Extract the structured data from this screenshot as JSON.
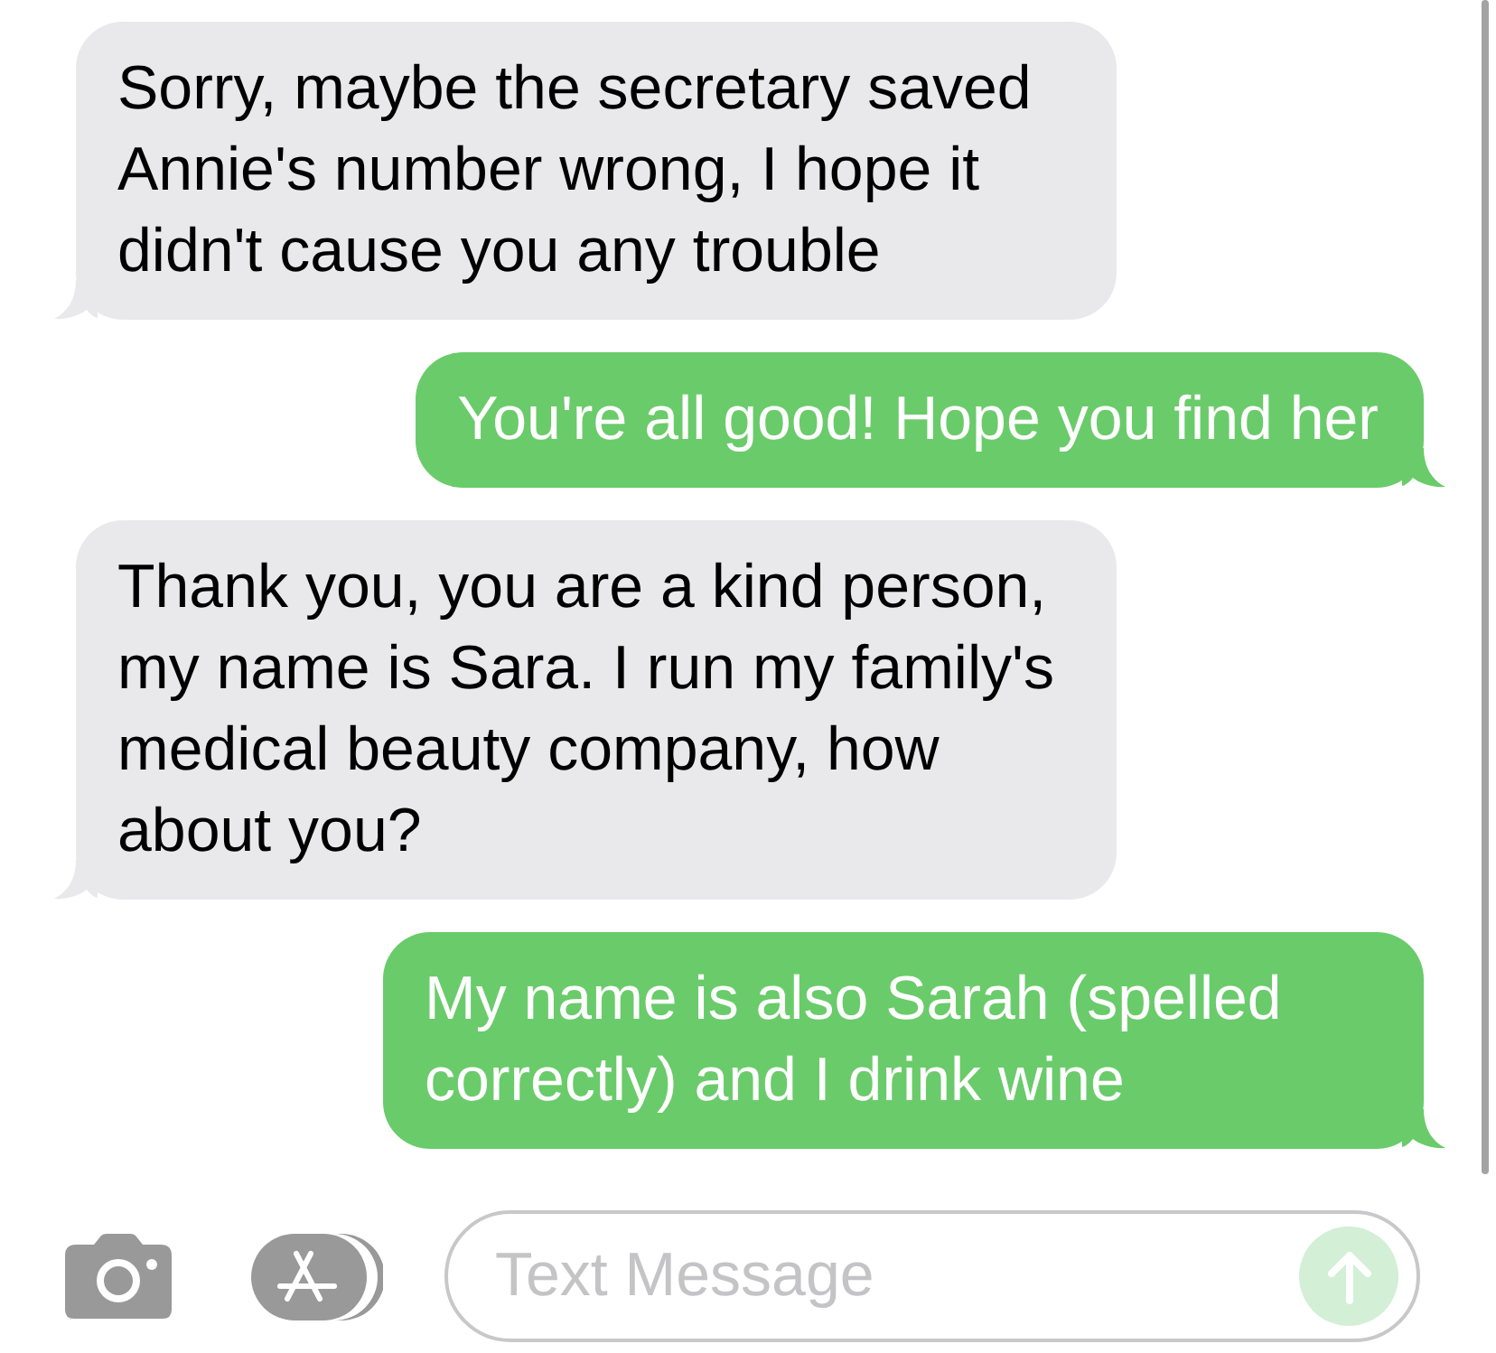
{
  "messages": [
    {
      "kind": "received",
      "text": "Sorry, maybe the secretary saved Annie's number wrong, I hope it didn't cause you any trouble"
    },
    {
      "kind": "sent",
      "text": "You're all good! Hope you find her"
    },
    {
      "kind": "received",
      "text": "Thank you, you are a kind person, my name is Sara. I run my family's medical beauty company, how about you?"
    },
    {
      "kind": "sent",
      "text": "My name is also Sarah (spelled correctly) and I drink wine"
    }
  ],
  "composer": {
    "placeholder": "Text Message",
    "send_disabled": true
  }
}
